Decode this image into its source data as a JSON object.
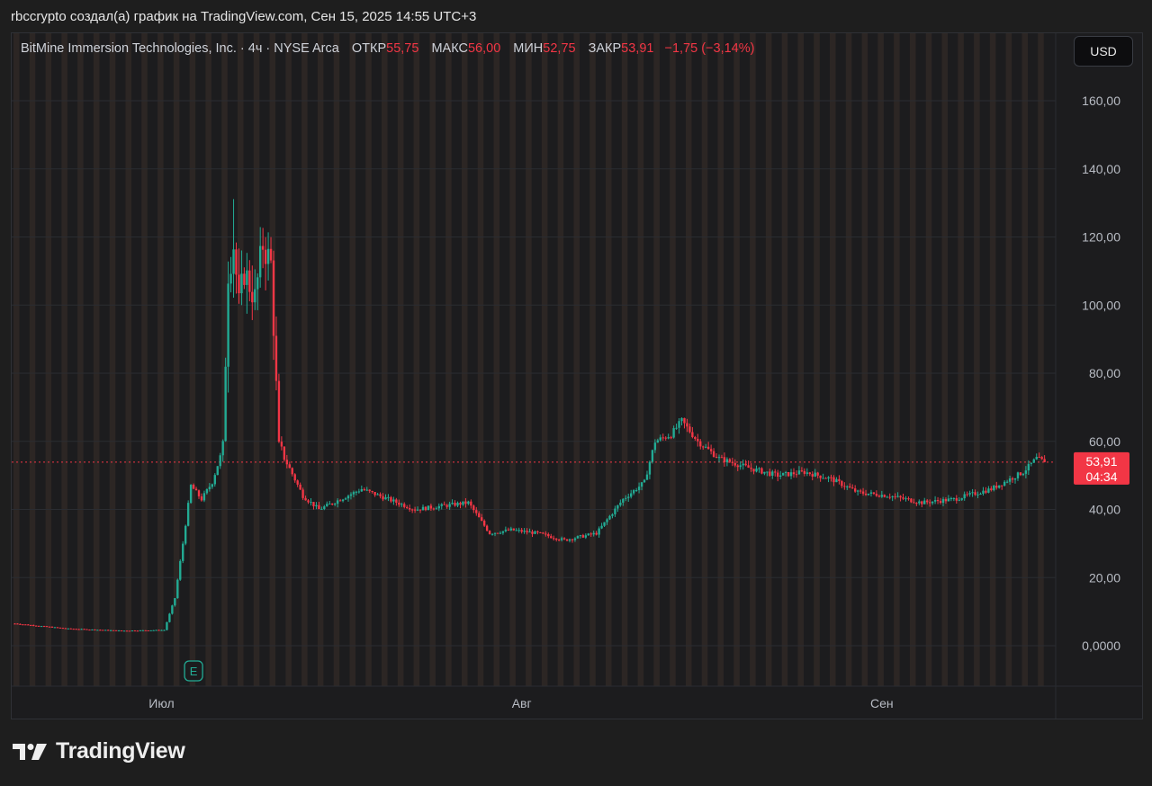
{
  "caption": "rbccrypto создал(а) график на TradingView.com, Сен 15, 2025 14:55 UTC+3",
  "legend": {
    "symbol": "BitMine Immersion Technologies, Inc. · 4ч · NYSE Arca",
    "open_label": "ОТКР",
    "open_value": "55,75",
    "high_label": "МАКС",
    "high_value": "56,00",
    "low_label": "МИН",
    "low_value": "52,75",
    "close_label": "ЗАКР",
    "close_value": "53,91",
    "change": "−1,75 (−3,14%)"
  },
  "currency_button": "USD",
  "brand": {
    "name": "TradingView",
    "logo_icon": "tradingview-logo-icon"
  },
  "colors": {
    "up": "#22ab94",
    "down": "#f23645",
    "background": "#1c1c1e",
    "session_band": "#3a2f2a",
    "grid": "#2a2c31",
    "axis_text": "#b8bcc4"
  },
  "chart_data": {
    "type": "candlestick",
    "title": "",
    "ylim": [
      -12,
      170
    ],
    "y_ticks": [
      {
        "value": 160,
        "label": "160,00"
      },
      {
        "value": 140,
        "label": "140,00"
      },
      {
        "value": 120,
        "label": "120,00"
      },
      {
        "value": 100,
        "label": "100,00"
      },
      {
        "value": 80,
        "label": "80,00"
      },
      {
        "value": 60,
        "label": "60,00"
      },
      {
        "value": 40,
        "label": "40,00"
      },
      {
        "value": 20,
        "label": "20,00"
      },
      {
        "value": 0,
        "label": "0,0000"
      }
    ],
    "x_ticks": [
      {
        "label": "Июл",
        "index": 55
      },
      {
        "label": "Авг",
        "index": 190
      },
      {
        "label": "Сен",
        "index": 325
      }
    ],
    "bars_count": 390,
    "last_price": {
      "value": 53.91,
      "label": "53,91",
      "countdown": "04:34"
    },
    "earnings_marker": {
      "label": "E",
      "index": 67
    },
    "price_path": [
      [
        0,
        6.5
      ],
      [
        20,
        5.0
      ],
      [
        40,
        4.4
      ],
      [
        56,
        4.6
      ],
      [
        60,
        14
      ],
      [
        63,
        30
      ],
      [
        66,
        47
      ],
      [
        70,
        43
      ],
      [
        74,
        48
      ],
      [
        78,
        58
      ],
      [
        80,
        110
      ],
      [
        82,
        118
      ],
      [
        84,
        100
      ],
      [
        86,
        110
      ],
      [
        90,
        102
      ],
      [
        93,
        118
      ],
      [
        96,
        112
      ],
      [
        99,
        58
      ],
      [
        103,
        52
      ],
      [
        108,
        44
      ],
      [
        114,
        40
      ],
      [
        130,
        46
      ],
      [
        150,
        40
      ],
      [
        170,
        42
      ],
      [
        178,
        33
      ],
      [
        186,
        34
      ],
      [
        196,
        33
      ],
      [
        206,
        31
      ],
      [
        218,
        33
      ],
      [
        228,
        43
      ],
      [
        236,
        48
      ],
      [
        240,
        60
      ],
      [
        246,
        62
      ],
      [
        250,
        66
      ],
      [
        256,
        60
      ],
      [
        264,
        55
      ],
      [
        276,
        52
      ],
      [
        286,
        50
      ],
      [
        296,
        51
      ],
      [
        306,
        49
      ],
      [
        316,
        45
      ],
      [
        328,
        44
      ],
      [
        340,
        42
      ],
      [
        352,
        43
      ],
      [
        366,
        46
      ],
      [
        378,
        51
      ],
      [
        383,
        55
      ],
      [
        386,
        53.9
      ]
    ]
  }
}
